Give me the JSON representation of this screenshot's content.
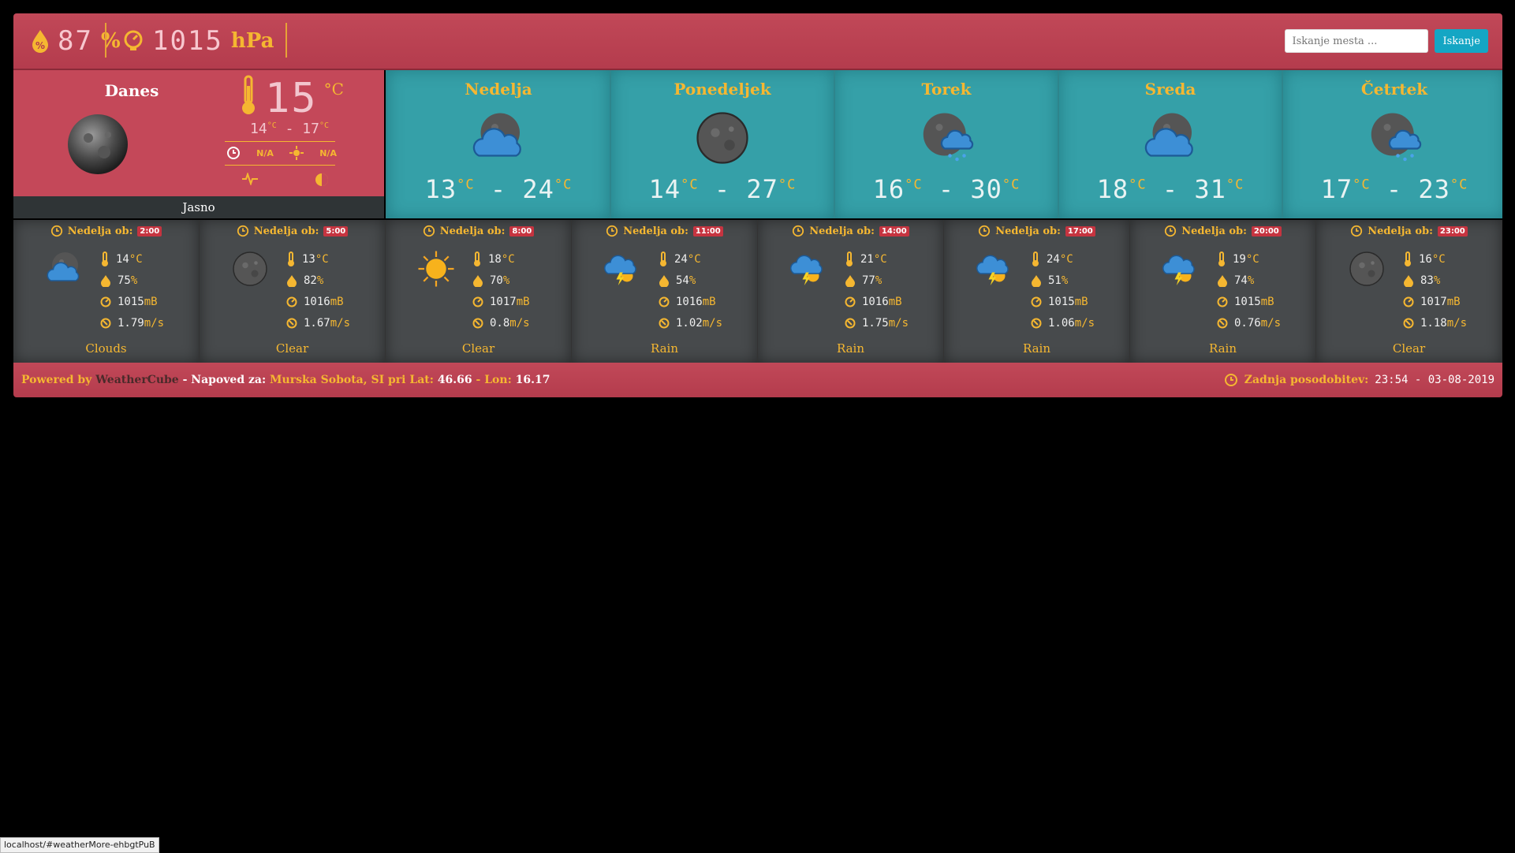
{
  "top": {
    "humidity": {
      "value": "87",
      "unit": "%"
    },
    "pressure": {
      "value": "1015",
      "unit": "hPa"
    },
    "search": {
      "placeholder": "Iskanje mesta ...",
      "button": "Iskanje"
    }
  },
  "today": {
    "label": "Danes",
    "temp": "15",
    "deg": "°C",
    "min": "14",
    "max": "17",
    "sunrise": "N/A",
    "sunset": "N/A",
    "description": "Jasno"
  },
  "days": [
    {
      "name": "Nedelja",
      "min": "13",
      "max": "24",
      "icon": "cloud-moon-icon"
    },
    {
      "name": "Ponedeljek",
      "min": "14",
      "max": "27",
      "icon": "moon-icon"
    },
    {
      "name": "Torek",
      "min": "16",
      "max": "30",
      "icon": "rain-moon-icon"
    },
    {
      "name": "Sreda",
      "min": "18",
      "max": "31",
      "icon": "cloud-moon-icon"
    },
    {
      "name": "Četrtek",
      "min": "17",
      "max": "23",
      "icon": "rain-moon-icon"
    }
  ],
  "hours_prefix": "Nedelja ob:",
  "hours": [
    {
      "time": "2:00",
      "temp": "14",
      "hum": "75",
      "press": "1015",
      "wind": "1.79",
      "desc": "Clouds",
      "icon": "cloud-moon-icon"
    },
    {
      "time": "5:00",
      "temp": "13",
      "hum": "82",
      "press": "1016",
      "wind": "1.67",
      "desc": "Clear",
      "icon": "moon-icon"
    },
    {
      "time": "8:00",
      "temp": "18",
      "hum": "70",
      "press": "1017",
      "wind": "0.8",
      "desc": "Clear",
      "icon": "sun-icon"
    },
    {
      "time": "11:00",
      "temp": "24",
      "hum": "54",
      "press": "1016",
      "wind": "1.02",
      "desc": "Rain",
      "icon": "storm-sun-icon"
    },
    {
      "time": "14:00",
      "temp": "21",
      "hum": "77",
      "press": "1016",
      "wind": "1.75",
      "desc": "Rain",
      "icon": "storm-sun-icon"
    },
    {
      "time": "17:00",
      "temp": "24",
      "hum": "51",
      "press": "1015",
      "wind": "1.06",
      "desc": "Rain",
      "icon": "storm-sun-icon"
    },
    {
      "time": "20:00",
      "temp": "19",
      "hum": "74",
      "press": "1015",
      "wind": "0.76",
      "desc": "Rain",
      "icon": "storm-sun-icon"
    },
    {
      "time": "23:00",
      "temp": "16",
      "hum": "83",
      "press": "1017",
      "wind": "1.18",
      "desc": "Clear",
      "icon": "moon-icon"
    }
  ],
  "units": {
    "deg": "°C",
    "pct": "%",
    "mb": "mB",
    "ms": "m/s"
  },
  "footer": {
    "powered": "Powered by",
    "brand": "WeatherCube",
    "forecast_for": "- Napoved za:",
    "place": "Murska Sobota, SI pri Lat:",
    "lat": "46.66",
    "lon_label": "- Lon:",
    "lon": "16.17",
    "updated_label": "Zadnja posodobitev:",
    "updated": "23:54 - 03-08-2019"
  },
  "status_url": "localhost/#weatherMore-ehbgtPuB",
  "colors": {
    "accent": "#f5b731",
    "red": "#c44859",
    "teal": "#35a0a8",
    "gray": "#474a4c"
  }
}
